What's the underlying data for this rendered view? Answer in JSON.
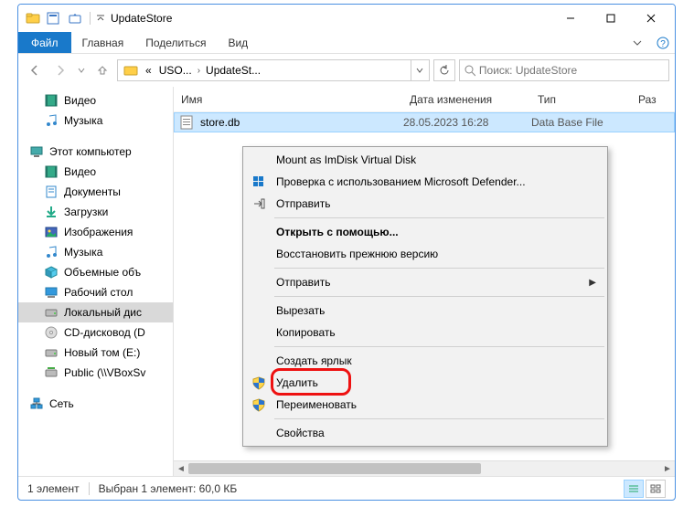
{
  "window": {
    "title": "UpdateStore"
  },
  "ribbon": {
    "file": "Файл",
    "tabs": [
      "Главная",
      "Поделиться",
      "Вид"
    ]
  },
  "nav": {
    "crumbs": [
      "USO...",
      "UpdateSt..."
    ],
    "prefix": "«"
  },
  "search": {
    "placeholder": "Поиск: UpdateStore"
  },
  "columns": {
    "name": "Имя",
    "date": "Дата изменения",
    "type": "Тип",
    "size": "Раз"
  },
  "file": {
    "name": "store.db",
    "date": "28.05.2023 16:28",
    "type": "Data Base File"
  },
  "sidebar": {
    "items": [
      {
        "label": "Видео",
        "icon": "film"
      },
      {
        "label": "Музыка",
        "icon": "music"
      },
      {
        "label": "",
        "icon": "spacer"
      },
      {
        "label": "Этот компьютер",
        "icon": "pc",
        "top": true
      },
      {
        "label": "Видео",
        "icon": "film"
      },
      {
        "label": "Документы",
        "icon": "doc"
      },
      {
        "label": "Загрузки",
        "icon": "down"
      },
      {
        "label": "Изображения",
        "icon": "pic"
      },
      {
        "label": "Музыка",
        "icon": "music"
      },
      {
        "label": "Объемные объ",
        "icon": "cube"
      },
      {
        "label": "Рабочий стол",
        "icon": "desk"
      },
      {
        "label": "Локальный дис",
        "icon": "drive",
        "sel": true
      },
      {
        "label": "CD-дисковод (D",
        "icon": "cd"
      },
      {
        "label": "Новый том (E:)",
        "icon": "drive"
      },
      {
        "label": "Public (\\\\VBoxSv",
        "icon": "net"
      },
      {
        "label": "",
        "icon": "spacer"
      },
      {
        "label": "Сеть",
        "icon": "network",
        "top": true
      }
    ]
  },
  "context_menu": {
    "items": [
      {
        "label": "Mount as ImDisk Virtual Disk"
      },
      {
        "label": "Проверка с использованием Microsoft Defender...",
        "icon": "shield-blue"
      },
      {
        "label": "Отправить",
        "icon": "share"
      },
      {
        "sep": true
      },
      {
        "label": "Открыть с помощью...",
        "bold": true
      },
      {
        "label": "Восстановить прежнюю версию"
      },
      {
        "sep": true
      },
      {
        "label": "Отправить",
        "submenu": true
      },
      {
        "sep": true
      },
      {
        "label": "Вырезать"
      },
      {
        "label": "Копировать"
      },
      {
        "sep": true
      },
      {
        "label": "Создать ярлык"
      },
      {
        "label": "Удалить",
        "icon": "shield-uac",
        "highlight": true
      },
      {
        "label": "Переименовать",
        "icon": "shield-uac"
      },
      {
        "sep": true
      },
      {
        "label": "Свойства"
      }
    ]
  },
  "status": {
    "count": "1 элемент",
    "selection": "Выбран 1 элемент: 60,0 КБ"
  }
}
